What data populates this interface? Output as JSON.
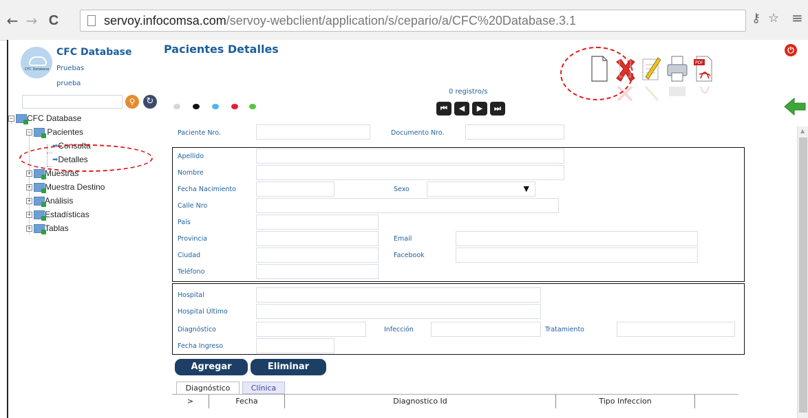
{
  "browser": {
    "back": "←",
    "forward": "→",
    "reload": "C",
    "url_host": "servoy.infocomsa.com",
    "url_path": "/servoy-webclient/application/s/cepario/a/CFC%20Database.3.1",
    "key_icon": "⚷",
    "star_icon": "☆",
    "menu_icon": "≡"
  },
  "sidebar": {
    "logo_text": "CFC Database",
    "title": "CFC Database",
    "sub1": "Pruebas",
    "sub2": "prueba",
    "search_placeholder": "",
    "tree": [
      {
        "label": "CFC Database",
        "level": 0,
        "expander": "−"
      },
      {
        "label": "Pacientes",
        "level": 1,
        "expander": "−"
      },
      {
        "label": "Consulta",
        "level": 2,
        "expander": ""
      },
      {
        "label": "Detalles",
        "level": 2,
        "expander": ""
      },
      {
        "label": "Muestras",
        "level": 1,
        "expander": "+"
      },
      {
        "label": "Muestra Destino",
        "level": 1,
        "expander": "+"
      },
      {
        "label": "Análisis",
        "level": 1,
        "expander": "+"
      },
      {
        "label": "Estadísticas",
        "level": 1,
        "expander": "+"
      },
      {
        "label": "Tablas",
        "level": 1,
        "expander": "+"
      }
    ]
  },
  "header": {
    "title": "Pacientes Detalles",
    "records": "0 registro/s",
    "dots": [
      "#d6d6d6",
      "#111111",
      "#4db6f0",
      "#e0203a",
      "#57c640"
    ],
    "nav": [
      "first",
      "prev",
      "next",
      "last"
    ],
    "tools": [
      "new-document",
      "delete",
      "edit",
      "print",
      "pdf"
    ]
  },
  "form": {
    "paciente_nro": "Paciente Nro.",
    "documento_nro": "Documento Nro.",
    "apellido": "Apellido",
    "nombre": "Nombre",
    "fecha_nacimiento": "Fecha Nacimiento",
    "sexo": "Sexo",
    "calle_nro": "Calle Nro",
    "pais": "País",
    "provincia": "Provincia",
    "email": "Email",
    "ciudad": "Ciudad",
    "facebook": "Facebook",
    "telefono": "Teléfono",
    "hospital": "Hospital",
    "hospital_ultimo": "Hospital Último",
    "diagnostico": "Diagnóstico",
    "infeccion": "Infección",
    "tratamiento": "Tratamiento",
    "fecha_ingreso": "Fecha Ingreso"
  },
  "buttons": {
    "agregar": "Agregar",
    "eliminar": "Eliminar"
  },
  "tabs": [
    "Diagnóstico",
    "Clínica"
  ],
  "grid_columns": [
    ">",
    "Fecha",
    "Diagnostico Id",
    "Tipo Infeccion"
  ]
}
